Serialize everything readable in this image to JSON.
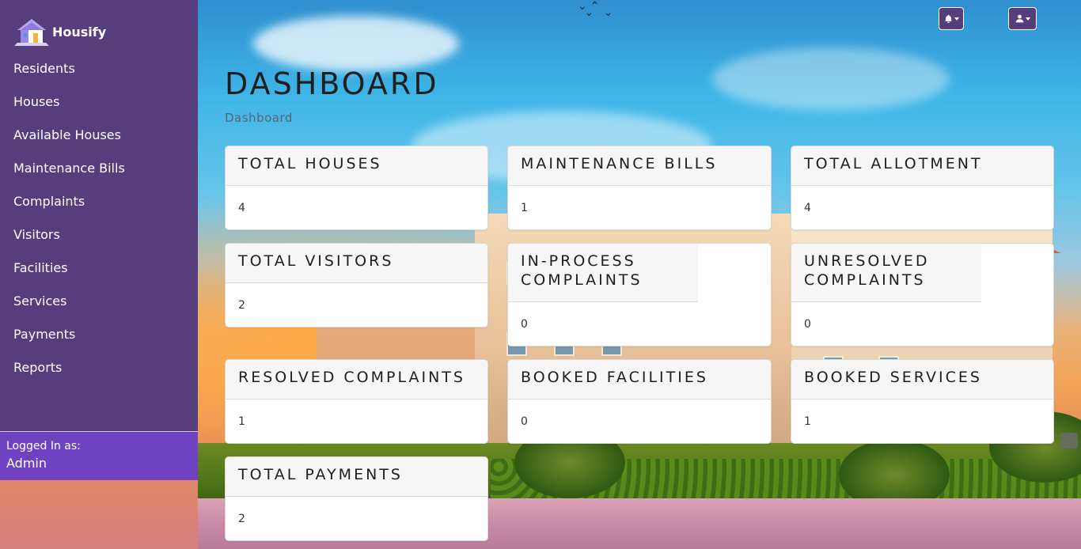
{
  "app": {
    "brand": "Housify"
  },
  "sidebar": {
    "items": [
      {
        "label": "Residents"
      },
      {
        "label": "Houses"
      },
      {
        "label": "Available Houses"
      },
      {
        "label": "Maintenance Bills"
      },
      {
        "label": "Complaints"
      },
      {
        "label": "Visitors"
      },
      {
        "label": "Facilities"
      },
      {
        "label": "Services"
      },
      {
        "label": "Payments"
      },
      {
        "label": "Reports"
      }
    ],
    "logged_in_label": "Logged In as:",
    "logged_in_user": "Admin"
  },
  "topbar": {
    "notifications_icon": "bell-icon",
    "user_icon": "user-icon"
  },
  "main": {
    "title": "DASHBOARD",
    "breadcrumb": "Dashboard",
    "cards": [
      {
        "title": "TOTAL HOUSES",
        "value": "4"
      },
      {
        "title": "MAINTENANCE BILLS",
        "value": "1"
      },
      {
        "title": "TOTAL ALLOTMENT",
        "value": "4"
      },
      {
        "title": "TOTAL VISITORS",
        "value": "2"
      },
      {
        "title": "IN-PROCESS COMPLAINTS",
        "value": "0"
      },
      {
        "title": "UNRESOLVED COMPLAINTS",
        "value": "0"
      },
      {
        "title": "RESOLVED COMPLAINTS",
        "value": "1"
      },
      {
        "title": "BOOKED FACILITIES",
        "value": "0"
      },
      {
        "title": "BOOKED SERVICES",
        "value": "1"
      },
      {
        "title": "TOTAL PAYMENTS",
        "value": "2"
      }
    ]
  },
  "colors": {
    "sidebar": "#563d7c",
    "logged_in_panel": "#6f42c1",
    "card_header": "#f6f6f6"
  }
}
